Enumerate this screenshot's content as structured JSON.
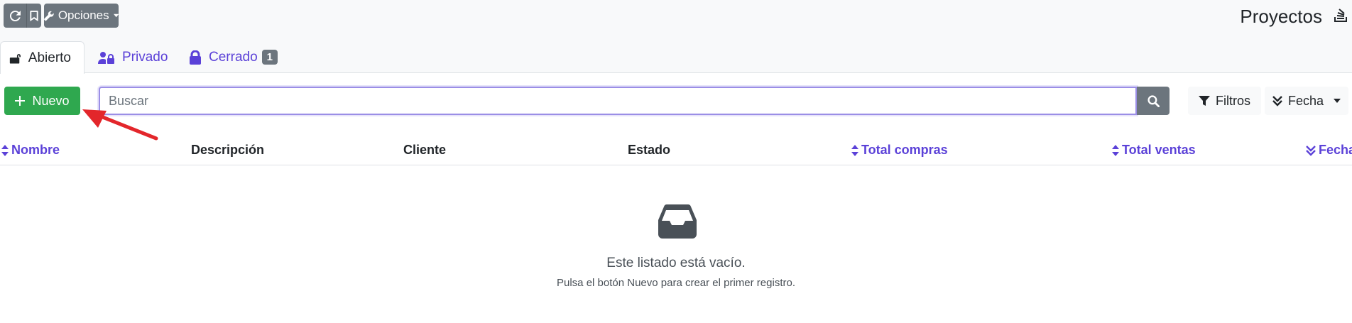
{
  "toolbar": {
    "refresh_icon": "refresh-icon",
    "bookmark_icon": "bookmark-icon",
    "options_label": "Opciones",
    "options_icon": "wrench-icon"
  },
  "header": {
    "title": "Proyectos",
    "title_icon": "layers-icon"
  },
  "tabs": [
    {
      "label": "Abierto",
      "icon": "unlock-icon",
      "active": true
    },
    {
      "label": "Privado",
      "icon": "user-lock-icon",
      "active": false
    },
    {
      "label": "Cerrado",
      "icon": "lock-icon",
      "active": false,
      "badge": "1"
    }
  ],
  "actions": {
    "new_label": "Nuevo",
    "search_placeholder": "Buscar",
    "filters_label": "Filtros",
    "sort_label": "Fecha"
  },
  "table": {
    "columns": [
      {
        "label": "Nombre",
        "sortable": true
      },
      {
        "label": "Descripción",
        "sortable": false
      },
      {
        "label": "Cliente",
        "sortable": false
      },
      {
        "label": "Estado",
        "sortable": false
      },
      {
        "label": "Total compras",
        "sortable": true
      },
      {
        "label": "Total ventas",
        "sortable": true
      },
      {
        "label": "Fecha",
        "sortable": true
      }
    ]
  },
  "empty": {
    "icon": "inbox-icon",
    "title": "Este listado está vacío.",
    "subtitle": "Pulsa el botón Nuevo para crear el primer registro."
  },
  "colors": {
    "accent": "#5b41d8",
    "new_button": "#2fa84f",
    "secondary": "#6c757d",
    "annotation_arrow": "#e3262b"
  }
}
